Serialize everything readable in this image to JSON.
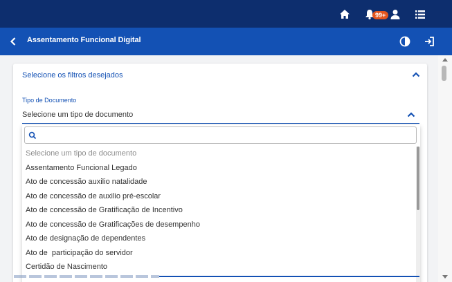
{
  "topbar": {
    "notification_count": "99+",
    "icons": [
      "home-icon",
      "bell-icon",
      "user-icon",
      "list-icon"
    ]
  },
  "appbar": {
    "title": "Assentamento Funcional Digital",
    "icons": [
      "back-arrow-icon",
      "contrast-icon",
      "logout-icon"
    ]
  },
  "filters": {
    "header": "Selecione os filtros desejados",
    "field_label": "Tipo de Documento",
    "selected_value": "Selecione um tipo de documento",
    "search_placeholder": "",
    "options": [
      "Selecione um tipo de documento",
      "Assentamento Funcional Legado",
      "Ato de concessão auxilio natalidade",
      "Ato de concessão de auxilio pré-escolar",
      "Ato de concessão de Gratificação de Incentivo",
      "Ato de concessão de Gratificações de desempenho",
      "Ato de designação de dependentes",
      "Ato de  participação do servidor",
      "Certidão de Nascimento"
    ]
  },
  "colors": {
    "topbar_bg": "#0d2e6e",
    "appbar_bg": "#1351b4",
    "accent": "#1351b4",
    "badge": "#e2561f"
  }
}
